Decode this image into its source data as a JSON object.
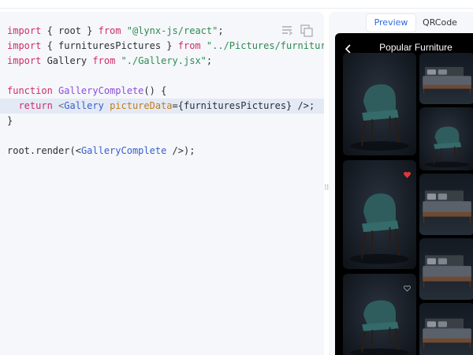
{
  "editor": {
    "lines": [
      [
        {
          "t": "import",
          "c": "kw"
        },
        {
          "t": " { root } ",
          "c": ""
        },
        {
          "t": "from",
          "c": "kw"
        },
        {
          "t": " ",
          "c": ""
        },
        {
          "t": "\"@lynx-js/react\"",
          "c": "str"
        },
        {
          "t": ";",
          "c": ""
        }
      ],
      [
        {
          "t": "import",
          "c": "kw"
        },
        {
          "t": " { furnituresPictures } ",
          "c": ""
        },
        {
          "t": "from",
          "c": "kw"
        },
        {
          "t": " ",
          "c": ""
        },
        {
          "t": "\"../Pictures/furnitures/f",
          "c": "str"
        }
      ],
      [
        {
          "t": "import",
          "c": "kw"
        },
        {
          "t": " Gallery ",
          "c": ""
        },
        {
          "t": "from",
          "c": "kw"
        },
        {
          "t": " ",
          "c": ""
        },
        {
          "t": "\"./Gallery.jsx\"",
          "c": "str"
        },
        {
          "t": ";",
          "c": ""
        }
      ],
      [],
      [
        {
          "t": "function",
          "c": "kw"
        },
        {
          "t": " ",
          "c": ""
        },
        {
          "t": "GalleryComplete",
          "c": "fn"
        },
        {
          "t": "() {",
          "c": ""
        }
      ],
      [
        {
          "t": "  return",
          "c": "kw"
        },
        {
          "t": " <",
          "c": "pun"
        },
        {
          "t": "Gallery",
          "c": "tag"
        },
        {
          "t": " ",
          "c": ""
        },
        {
          "t": "pictureData",
          "c": "attr"
        },
        {
          "t": "={furnituresPictures} />;",
          "c": ""
        }
      ],
      [
        {
          "t": "}",
          "c": ""
        }
      ],
      [],
      [
        {
          "t": "root",
          "c": ""
        },
        {
          "t": ".render(<",
          "c": ""
        },
        {
          "t": "GalleryComplete",
          "c": "tag"
        },
        {
          "t": " />);",
          "c": ""
        }
      ]
    ],
    "highlight_line": 5,
    "icons": [
      "format-icon",
      "copy-icon"
    ]
  },
  "preview": {
    "tabs": [
      {
        "label": "Preview",
        "active": true
      },
      {
        "label": "QRCode",
        "active": false
      }
    ],
    "phone": {
      "title": "Popular Furniture",
      "heart_color_liked": "#e0353b",
      "heart_color_outline": "#9aa0a8"
    },
    "cards": [
      {
        "kind": "chair",
        "liked": null
      },
      {
        "kind": "bed",
        "liked": null
      },
      {
        "kind": "chair",
        "liked": null
      },
      {
        "kind": "chair",
        "liked": true
      },
      {
        "kind": "bed",
        "liked": null
      },
      {
        "kind": "bed",
        "liked": null
      },
      {
        "kind": "chair",
        "liked": false
      },
      {
        "kind": "bed",
        "liked": null
      }
    ]
  },
  "colors": {
    "accent": "#2f6be0",
    "code_bg": "#f5f7fa",
    "highlight_bg": "#e3eaf5",
    "keyword": "#cf2c6a",
    "string": "#2f8a52"
  }
}
